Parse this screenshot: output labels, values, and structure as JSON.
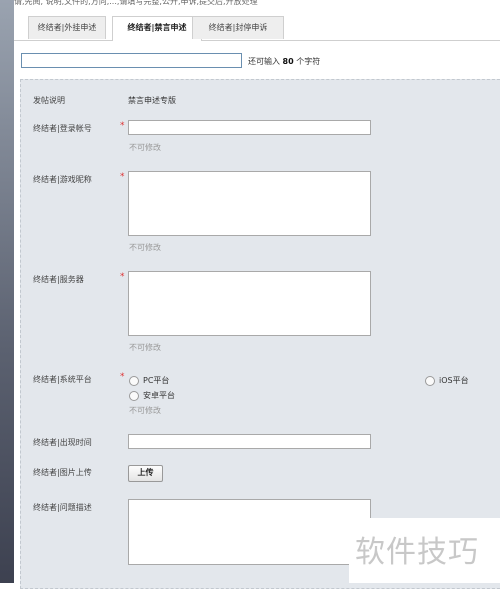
{
  "top_note": "请,先阅, 说明,文件的,方向,...,请填写完整,公开,申诉,提交后,开放处理",
  "tabs": [
    {
      "label": "终结者|外挂申述"
    },
    {
      "label": "终结者|禁言申述"
    },
    {
      "label": "终结者|封停申诉"
    }
  ],
  "title_input": {
    "value": ""
  },
  "char_hint": {
    "prefix": "还可输入",
    "count": "80",
    "suffix": "个字符"
  },
  "form": {
    "post_desc_label": "发帖说明",
    "post_desc_value": "禁言申述专版",
    "account_label": "终结者|登录帐号",
    "nickname_label": "终结者|游戏昵称",
    "server_label": "终结者|服务器",
    "platform_label": "终结者|系统平台",
    "time_label": "终结者|出现时间",
    "image_label": "终结者|图片上传",
    "problem_label": "终结者|问题描述",
    "required_mark": "*",
    "not_editable": "不可修改",
    "platform_options": [
      "PC平台",
      "iOS平台",
      "安卓平台"
    ],
    "upload_button": "上传"
  },
  "watermark": "软件技巧"
}
